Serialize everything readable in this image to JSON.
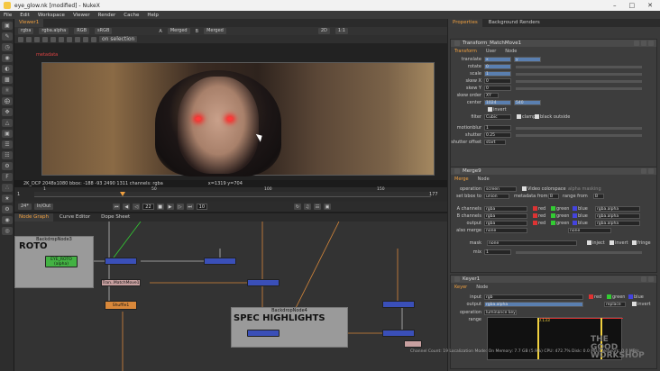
{
  "window": {
    "title": "eye_glow.nk [modified] - NukeX"
  },
  "menu": [
    "File",
    "Edit",
    "Workspace",
    "Viewer",
    "Render",
    "Cache",
    "Help"
  ],
  "viewer": {
    "tab": "Viewer1",
    "channels": "rgba",
    "alpha": "rgba.alpha",
    "colorspace": "RGB",
    "lut": "sRGB",
    "input_a": "A",
    "input_a_node": "Merged",
    "input_b": "B",
    "input_b_node": "Merged",
    "zoom": "1:1",
    "proxy": "2D",
    "overlay_label": "on selection",
    "red_label": "metadata",
    "info_left": "2K_DCP 2048x1080  bbox: -188 -93 2490 1311 channels: rgba",
    "info_coords": "x=1319 y=704",
    "fps": "24*",
    "range": "In/Out",
    "frame": "22",
    "end_frame": "177",
    "tl_start": "1",
    "tl_marks": [
      "1",
      "50",
      "100",
      "150"
    ],
    "skip": "10"
  },
  "nodegraph": {
    "tabs": [
      "Node Graph",
      "Curve Editor",
      "Dope Sheet"
    ],
    "backdrops": [
      {
        "label": "BackdropNode3",
        "title": "ROTO"
      },
      {
        "label": "BackdropNode4",
        "title": "SPEC HIGHLIGHTS"
      }
    ],
    "nodes": {
      "roto": "EYE_ROTO",
      "roto_sub": "(alpha)",
      "transform": "Tran..MatchMove1",
      "shuffle": "Shuffle1"
    }
  },
  "properties": {
    "tabs": [
      "Properties",
      "Background Renders"
    ],
    "transform": {
      "name": "Transform_MatchMove1",
      "tabs": [
        "Transform",
        "User",
        "Node"
      ],
      "fields": [
        "translate",
        "rotate",
        "scale",
        "skew X",
        "skew Y",
        "skew order",
        "center",
        "",
        "filter",
        "",
        "motionblur",
        "shutter",
        "shutter offset"
      ],
      "translate_x": "x",
      "translate_y": "y",
      "rotate": "0",
      "scale": "1",
      "skew_x": "0",
      "skew_y": "0",
      "skew_order": "XY",
      "center_x": "1024",
      "center_y": "540",
      "invert": "invert",
      "filter": "Cubic",
      "clamp": "clamp",
      "black_outside": "black outside",
      "motionblur": "1",
      "shutter": "0.25",
      "shutter_offset": "start"
    },
    "merge": {
      "name": "Merge9",
      "tabs": [
        "Merge",
        "Node"
      ],
      "operation_label": "operation",
      "operation": "screen",
      "video_colorspace": "Video colorspace",
      "alpha_masking": "alpha masking",
      "set_bbox_label": "set bbox to",
      "set_bbox": "union",
      "metadata_from": "metadata from",
      "metadata_val": "B",
      "range_from": "range from",
      "range_val": "B",
      "a_channels": "A channels",
      "b_channels": "B channels",
      "output": "output",
      "also_merge": "also merge",
      "ch_rgba": "rgba",
      "ch_none": "none",
      "red": "red",
      "green": "green",
      "blue": "blue",
      "alpha_ch": "rgba.alpha",
      "mask": "mask",
      "mask_val": "none",
      "inject": "inject",
      "invert": "invert",
      "fringe": "fringe",
      "mix": "mix",
      "mix_val": "1"
    },
    "keyer": {
      "name": "Keyer1",
      "tabs": [
        "Keyer",
        "Node"
      ],
      "input_label": "input",
      "input": "rgb",
      "output_label": "output",
      "output": "rgba.alpha",
      "replace": "replace",
      "invert": "invert",
      "operation_label": "operation",
      "operation": "luminance key",
      "range_label": "range",
      "range_val": "0.133"
    }
  },
  "status": "Channel Count: 19  Localization Mode: On  Memory: 7.7 GB (5.9%)  CPU: 472.7%  Disk: 0.0 MB/s  Network: 0.0 MB/s",
  "watermark": [
    "THE",
    "GOOD",
    "WORKSHOP"
  ]
}
